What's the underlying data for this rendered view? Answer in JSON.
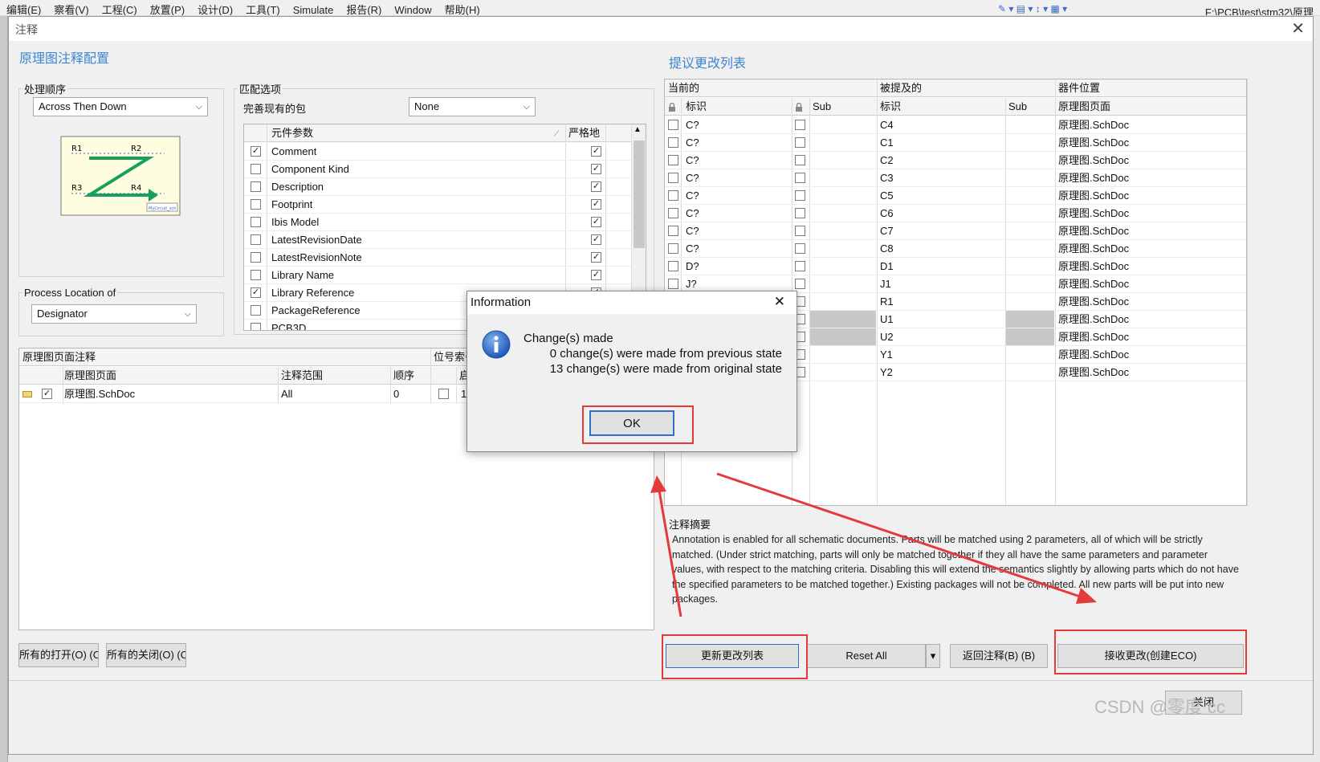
{
  "menubar": {
    "items": [
      "编辑(E)",
      "察看(V)",
      "工程(C)",
      "放置(P)",
      "设计(D)",
      "工具(T)",
      "Simulate",
      "报告(R)",
      "Window",
      "帮助(H)"
    ],
    "path": "F:\\PCB\\test\\stm32\\原理"
  },
  "dialog": {
    "title": "注释",
    "close_glyph": "✕",
    "left_heading": "原理图注释配置",
    "right_heading": "提议更改列表",
    "order_group": {
      "legend": "处理顺序",
      "selected": "Across Then Down",
      "preview_labels": [
        "R1",
        "R2",
        "R3",
        "R4"
      ],
      "preview_caption": "MyCircuit_sch"
    },
    "process_location": {
      "legend": "Process Location of",
      "selected": "Designator"
    },
    "match_group": {
      "legend": "匹配选项",
      "complete_label": "完善现有的包",
      "complete_value": "None",
      "col_param": "元件参数",
      "col_strict": "严格地",
      "params": [
        {
          "name": "Comment",
          "checked": true,
          "strict": true
        },
        {
          "name": "Component Kind",
          "checked": false,
          "strict": true
        },
        {
          "name": "Description",
          "checked": false,
          "strict": true
        },
        {
          "name": "Footprint",
          "checked": false,
          "strict": true
        },
        {
          "name": "Ibis Model",
          "checked": false,
          "strict": true
        },
        {
          "name": "LatestRevisionDate",
          "checked": false,
          "strict": true
        },
        {
          "name": "LatestRevisionNote",
          "checked": false,
          "strict": true
        },
        {
          "name": "Library Name",
          "checked": false,
          "strict": true
        },
        {
          "name": "Library Reference",
          "checked": true,
          "strict": true
        },
        {
          "name": "PackageReference",
          "checked": false,
          "strict": true
        },
        {
          "name": "PCB3D",
          "checked": false,
          "strict": true
        }
      ]
    },
    "sheet_table": {
      "title": "原理图页面注释",
      "title2": "位号索引",
      "headers": {
        "sheet": "原理图页面",
        "scope": "注释范围",
        "order": "顺序",
        "start": "启"
      },
      "rows": [
        {
          "sheet": "原理图.SchDoc",
          "scope": "All",
          "order": "0",
          "start": "1",
          "checked": true
        }
      ]
    },
    "changes_table": {
      "group_current": "当前的",
      "group_proposed": "被提及的",
      "group_location": "器件位置",
      "col_designator": "标识",
      "col_sub": "Sub",
      "col_sheet": "原理图页面",
      "rows": [
        {
          "cur": "C?",
          "new": "C4",
          "sheet": "原理图.SchDoc"
        },
        {
          "cur": "C?",
          "new": "C1",
          "sheet": "原理图.SchDoc"
        },
        {
          "cur": "C?",
          "new": "C2",
          "sheet": "原理图.SchDoc"
        },
        {
          "cur": "C?",
          "new": "C3",
          "sheet": "原理图.SchDoc"
        },
        {
          "cur": "C?",
          "new": "C5",
          "sheet": "原理图.SchDoc"
        },
        {
          "cur": "C?",
          "new": "C6",
          "sheet": "原理图.SchDoc"
        },
        {
          "cur": "C?",
          "new": "C7",
          "sheet": "原理图.SchDoc"
        },
        {
          "cur": "C?",
          "new": "C8",
          "sheet": "原理图.SchDoc"
        },
        {
          "cur": "D?",
          "new": "D1",
          "sheet": "原理图.SchDoc"
        },
        {
          "cur": "J?",
          "new": "J1",
          "sheet": "原理图.SchDoc"
        },
        {
          "cur": "",
          "new": "R1",
          "sheet": "原理图.SchDoc"
        },
        {
          "cur": "",
          "new": "U1",
          "sheet": "原理图.SchDoc"
        },
        {
          "cur": "",
          "new": "U2",
          "sheet": "原理图.SchDoc"
        },
        {
          "cur": "",
          "new": "Y1",
          "sheet": "原理图.SchDoc"
        },
        {
          "cur": "",
          "new": "Y2",
          "sheet": "原理图.SchDoc"
        }
      ]
    },
    "summary": {
      "title": "注释摘要",
      "text": "Annotation is enabled for all schematic documents. Parts will be matched using 2 parameters, all of which will be strictly matched. (Under strict matching, parts will only be matched together if they all have the same parameters and parameter values, with respect to the matching criteria. Disabling this will extend the semantics slightly by allowing parts which do not have the specified parameters to be matched together.) Existing packages will not be completed. All new parts will be put into new packages."
    },
    "buttons": {
      "open_all": "所有的打开(O) (O",
      "close_all": "所有的关闭(O) (O",
      "update_list": "更新更改列表",
      "reset_all": "Reset All",
      "reset_arrow": "▾",
      "back": "返回注释(B) (B)",
      "accept": "接收更改(创建ECO)",
      "close": "关闭"
    }
  },
  "info_dialog": {
    "title": "Information",
    "close_glyph": "✕",
    "line1": "Change(s) made",
    "line2": "0 change(s) were made from previous state",
    "line3": "13 change(s) were made from original state",
    "ok": "OK"
  },
  "watermark": "CSDN @零度 cc",
  "colors": {
    "accent": "#3c85cf",
    "highlight": "#e53a3a",
    "arrow": "#17a05d"
  }
}
